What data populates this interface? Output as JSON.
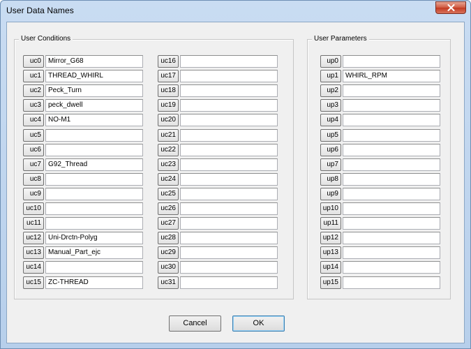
{
  "window": {
    "title": "User Data Names"
  },
  "user_conditions": {
    "legend": "User Conditions",
    "items": [
      {
        "label": "uc0",
        "value": "Mirror_G68"
      },
      {
        "label": "uc1",
        "value": "THREAD_WHIRL"
      },
      {
        "label": "uc2",
        "value": "Peck_Turn"
      },
      {
        "label": "uc3",
        "value": "peck_dwell"
      },
      {
        "label": "uc4",
        "value": "NO-M1"
      },
      {
        "label": "uc5",
        "value": ""
      },
      {
        "label": "uc6",
        "value": ""
      },
      {
        "label": "uc7",
        "value": "G92_Thread"
      },
      {
        "label": "uc8",
        "value": ""
      },
      {
        "label": "uc9",
        "value": ""
      },
      {
        "label": "uc10",
        "value": ""
      },
      {
        "label": "uc11",
        "value": ""
      },
      {
        "label": "uc12",
        "value": "Uni-Drctn-Polyg"
      },
      {
        "label": "uc13",
        "value": "Manual_Part_ejc"
      },
      {
        "label": "uc14",
        "value": ""
      },
      {
        "label": "uc15",
        "value": "ZC-THREAD"
      },
      {
        "label": "uc16",
        "value": ""
      },
      {
        "label": "uc17",
        "value": ""
      },
      {
        "label": "uc18",
        "value": ""
      },
      {
        "label": "uc19",
        "value": ""
      },
      {
        "label": "uc20",
        "value": ""
      },
      {
        "label": "uc21",
        "value": ""
      },
      {
        "label": "uc22",
        "value": ""
      },
      {
        "label": "uc23",
        "value": ""
      },
      {
        "label": "uc24",
        "value": ""
      },
      {
        "label": "uc25",
        "value": ""
      },
      {
        "label": "uc26",
        "value": ""
      },
      {
        "label": "uc27",
        "value": ""
      },
      {
        "label": "uc28",
        "value": ""
      },
      {
        "label": "uc29",
        "value": ""
      },
      {
        "label": "uc30",
        "value": ""
      },
      {
        "label": "uc31",
        "value": ""
      }
    ]
  },
  "user_parameters": {
    "legend": "User Parameters",
    "items": [
      {
        "label": "up0",
        "value": ""
      },
      {
        "label": "up1",
        "value": "WHIRL_RPM"
      },
      {
        "label": "up2",
        "value": ""
      },
      {
        "label": "up3",
        "value": ""
      },
      {
        "label": "up4",
        "value": ""
      },
      {
        "label": "up5",
        "value": ""
      },
      {
        "label": "up6",
        "value": ""
      },
      {
        "label": "up7",
        "value": ""
      },
      {
        "label": "up8",
        "value": ""
      },
      {
        "label": "up9",
        "value": ""
      },
      {
        "label": "up10",
        "value": ""
      },
      {
        "label": "up11",
        "value": ""
      },
      {
        "label": "up12",
        "value": ""
      },
      {
        "label": "up13",
        "value": ""
      },
      {
        "label": "up14",
        "value": ""
      },
      {
        "label": "up15",
        "value": ""
      }
    ]
  },
  "buttons": {
    "cancel": "Cancel",
    "ok": "OK"
  },
  "colors": {
    "title_bar": "#c9dcf2",
    "dialog_bg": "#f0f0f0",
    "close_button": "#c9432b"
  }
}
